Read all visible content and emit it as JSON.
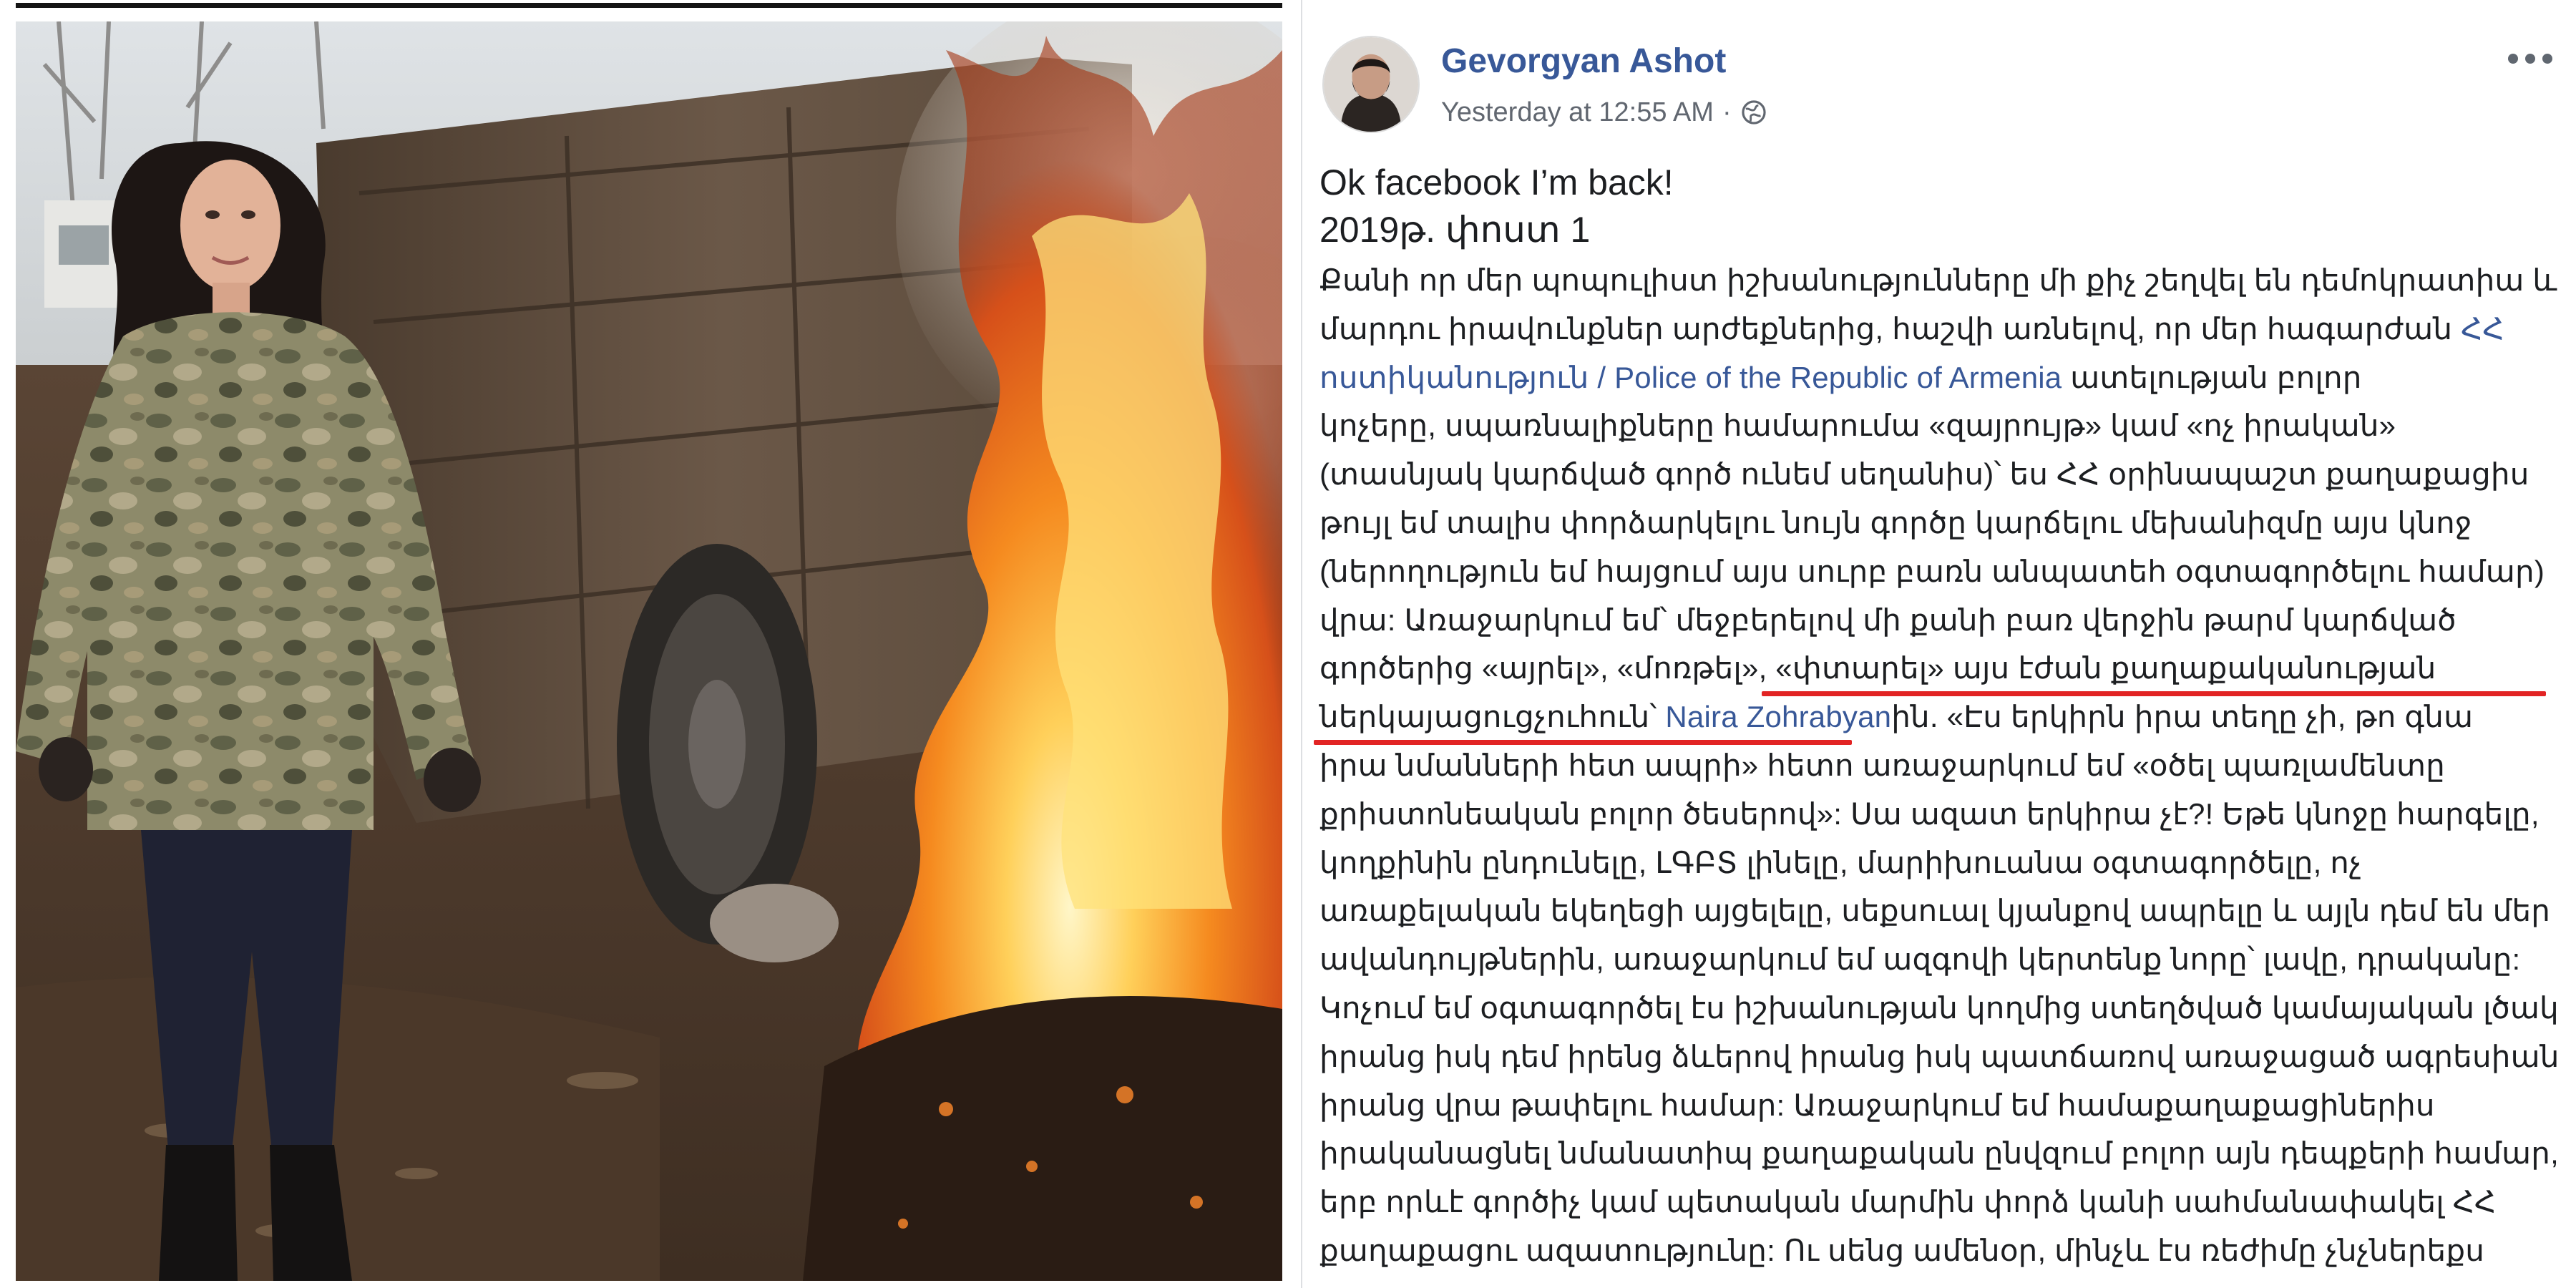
{
  "post": {
    "author": "Gevorgyan Ashot",
    "timestamp": "Yesterday at 12:55 AM",
    "separator": "·",
    "privacy_icon": "globe-icon",
    "more_icon": "more-options-icon",
    "intro": "Ok facebook I’m back!",
    "dateline": "2019թ. փոստ 1",
    "body": {
      "line1": "Քանի որ մեր պոպուլիստ իշխանությունները մի քիչ շեղվել են դեմոկրատիա և",
      "line2": "մարդու իրավունքներ արժեքներից, հաշվի առնելով, որ մեր հագարժան",
      "link_police_1": "ՀՀ",
      "link_police_2": "ոստիկանություն / Police of the Republic of Armenia",
      "line3_after": "ատելության բոլոր",
      "line4": "կոչերը, սպառնալիքները համարումա «զայրույթ» կամ «ոչ իրական»",
      "line5": "(տասնյակ կարճված գործ ունեմ սեղանիս)՝ ես ՀՀ օրինապաշտ քաղաքացիս",
      "line6": "թույլ եմ տալիս փորձարկելու նույն գործը կարճելու մեխանիզմը այս կնոջ",
      "line7": "(ներողություն եմ հայցում այս սուրբ բառն անպատեհ օգտագործելու համար)",
      "line8": "վրա: Առաջարկում եմ՝ մեջբերելով մի քանի բառ վերջին թարմ կարճված",
      "line9": "գործերից «այրել», «մոռթել», «փտարել» այս էժան քաղաքականության",
      "line10_before": "ներկայացուցչուհուն՝",
      "link_naira": "Naira Zohrabyan",
      "line10_after": "ին. «Էս երկիրն իրա տեղը չի, թո գնա",
      "line11": "իրա նմանների հետ ապրի» հետո առաջարկում եմ «օծել պառլամենտը",
      "line12": "քրիստոնեական բոլոր ծեսերով»: Սա ազատ երկիրա չէ?! Եթե կնոջը հարգելը,",
      "line13": "կողքինին ընդունելը, ԼԳԲՏ լինելը, մարիխուանա օգտագործելը, ոչ",
      "line14": "առաքելական եկեղեցի այցելելը, սեքսուալ կյանքով ապրելը և այլն դեմ են մեր",
      "line15": "ավանդույթներին, առաջարկում եմ ազգովի կերտենք նորը՝ լավը, դրականը:",
      "line16": "Կոչում եմ օգտագործել էս իշխանության կողմից ստեղծված կամայական լծակ",
      "line17": "իրանց իսկ դեմ իրենց ձևերով իրանց իսկ պատճառով առաջացած ագրեսիան",
      "line18": "իրանց վրա թափելու համար: Առաջարկում եմ համաքաղաքացիներիս",
      "line19": "իրականացնել նմանատիպ քաղաքական ընվզում բոլոր այն դեպքերի համար,",
      "line20": "երբ որևէ գործիչ կամ պետական մարմին փորձ կանի սահմանափակել ՀՀ",
      "line21": "քաղաքացու ազատությունը: Ու սենց ամենօր, մինչև էս ռեժիմը չնչներեքս"
    }
  },
  "colors": {
    "author": "#385898",
    "link": "#385898",
    "meta": "#616770",
    "text": "#1c1e21",
    "annotation_underline": "#e22424"
  }
}
